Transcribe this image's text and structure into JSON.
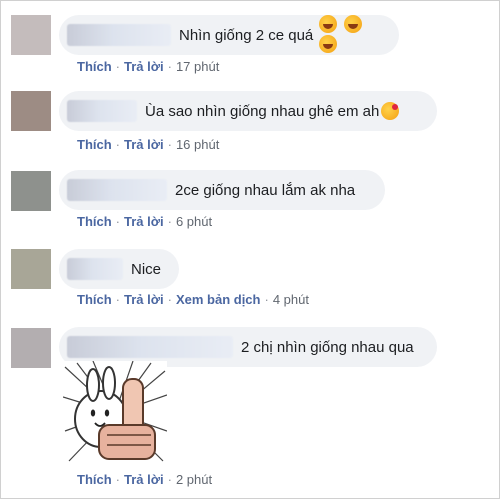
{
  "comments": [
    {
      "text": "Nhìn giống 2 ce quá",
      "emojis": [
        "rolling-on-floor-laughing",
        "rolling-on-floor-laughing",
        "rolling-on-floor-laughing"
      ],
      "actions": {
        "like": "Thích",
        "reply": "Trả lời",
        "time": "17 phút"
      }
    },
    {
      "text": "Ùa sao nhìn giống nhau ghê em ah",
      "emojis": [
        "face-blowing-a-kiss"
      ],
      "actions": {
        "like": "Thích",
        "reply": "Trả lời",
        "time": "16 phút"
      }
    },
    {
      "text": "2ce giống nhau lắm ak nha",
      "emojis": [],
      "actions": {
        "like": "Thích",
        "reply": "Trả lời",
        "time": "6 phút"
      }
    },
    {
      "text": "Nice",
      "emojis": [],
      "actions": {
        "like": "Thích",
        "reply": "Trả lời",
        "translate": "Xem bản dịch",
        "time": "4 phút"
      }
    },
    {
      "text": "2 chị nhìn giống nhau qua",
      "emojis": [],
      "sticker": "bunny-thumbs-up-sticker",
      "actions": {
        "like": "Thích",
        "reply": "Trả lời",
        "time": "2 phút"
      }
    }
  ],
  "colors": {
    "bubble": "#f0f2f5",
    "link": "#4b67a1",
    "text": "#1c1e21"
  }
}
